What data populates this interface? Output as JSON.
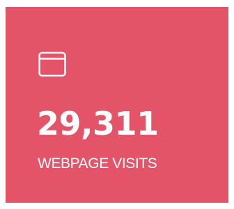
{
  "card": {
    "icon": "browser-window-icon",
    "value": "29,311",
    "label": "WEBPAGE VISITS",
    "background_color": "#e45468",
    "text_color": "#ffffff"
  }
}
